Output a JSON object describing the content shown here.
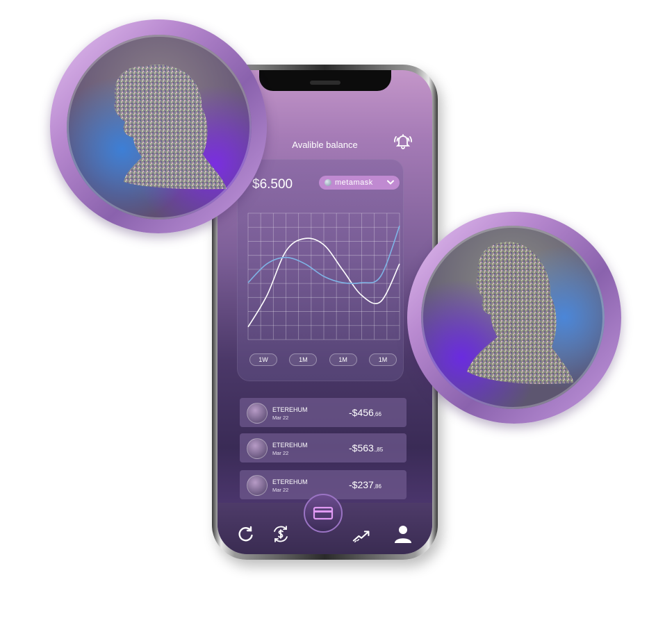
{
  "header": {
    "title": "Avalible balance",
    "notification_icon": "bell-ringing-icon"
  },
  "balance": {
    "amount": "$6.500",
    "wallet": "metamask",
    "wallet_icon": "chevron-down-icon"
  },
  "chart_data": {
    "type": "line",
    "grid": true,
    "series": [
      {
        "values": [
          2,
          7,
          14,
          16,
          15,
          11,
          7,
          6,
          12
        ]
      },
      {
        "values": [
          9,
          12,
          13,
          12,
          10,
          9,
          9,
          10,
          18
        ]
      }
    ]
  },
  "range_buttons": [
    "1W",
    "1M",
    "1M",
    "1M"
  ],
  "transactions": [
    {
      "name": "ETEREHUM",
      "date": "Mar 22",
      "amount": "-$456",
      "cents": ",66"
    },
    {
      "name": "ETEREHUM",
      "date": "Mar 22",
      "amount": "-$563",
      "cents": ".,85"
    },
    {
      "name": "ETEREHUM",
      "date": "Mar 22",
      "amount": "-$237",
      "cents": ",86"
    }
  ],
  "nav": {
    "items": [
      "refresh-icon",
      "exchange-dollar-icon",
      "card-icon",
      "trend-up-icon",
      "user-icon"
    ]
  },
  "colors": {
    "accent": "#c08ad1",
    "coin_rim": "#b98ad0",
    "line_white": "#ffffff",
    "line_blue": "#7fb4e6"
  }
}
